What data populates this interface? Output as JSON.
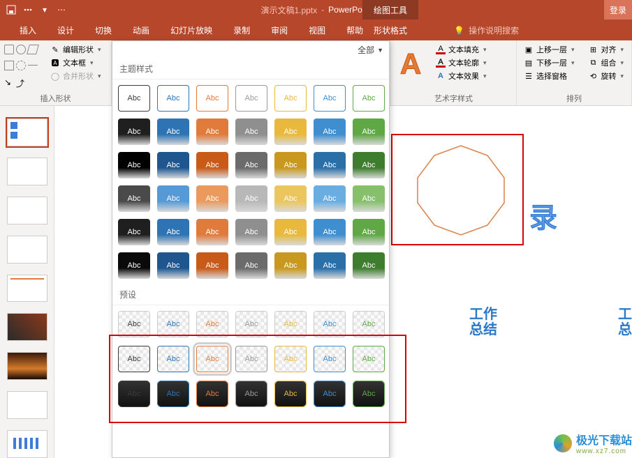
{
  "title": {
    "filename": "演示文稿1.pptx",
    "separator": "-",
    "appname": "PowerPoint",
    "context_tool": "绘图工具",
    "login": "登录"
  },
  "tabs": {
    "insert": "插入",
    "design": "设计",
    "transition": "切换",
    "animation": "动画",
    "slideshow": "幻灯片放映",
    "record": "录制",
    "review": "审阅",
    "view": "视图",
    "help": "帮助",
    "shape_format": "形状格式",
    "tellme": "操作说明搜索"
  },
  "ribbon": {
    "insert_shape_group": "插入形状",
    "edit_shape": "编辑形状",
    "text_box": "文本框",
    "merge_shape": "合并形状",
    "wordart_group": "艺术字样式",
    "text_fill": "文本填充",
    "text_outline": "文本轮廓",
    "text_effect": "文本效果",
    "arrange_group": "排列",
    "bring_forward": "上移一层",
    "send_backward": "下移一层",
    "selection_pane": "选择窗格",
    "align": "对齐",
    "group": "组合",
    "rotate": "旋转"
  },
  "gallery": {
    "filter_all": "全部",
    "section_theme": "主题样式",
    "section_preset": "预设",
    "sample_text": "Abc",
    "row1_colors": [
      "#3a3a3a",
      "#2e74b5",
      "#e07b3c",
      "#9a9a9a",
      "#e8b93c",
      "#3e8ed0",
      "#5fa845"
    ],
    "solid_rows": [
      [
        "#1f1f1f",
        "#2e74b5",
        "#e07b3c",
        "#8f8f8f",
        "#e8b93c",
        "#3e8ed0",
        "#5fa845"
      ],
      [
        "#000000",
        "#1f5690",
        "#c85a1a",
        "#6b6b6b",
        "#c9981e",
        "#2a6fa8",
        "#3f7d2e"
      ],
      [
        "#4a4a4a",
        "#559ad6",
        "#ea9a5d",
        "#b8b8b8",
        "#ecc55e",
        "#6aade0",
        "#86c06a"
      ],
      [
        "#1f1f1f",
        "#2e74b5",
        "#e07b3c",
        "#8f8f8f",
        "#e8b93c",
        "#3e8ed0",
        "#5fa845"
      ],
      [
        "#0a0a0a",
        "#1f5690",
        "#c85a1a",
        "#6b6b6b",
        "#c9981e",
        "#2a6fa8",
        "#3f7d2e"
      ]
    ],
    "preset_colors": [
      "#3a3a3a",
      "#2e74b5",
      "#e07b3c",
      "#9a9a9a",
      "#e8b93c",
      "#3e8ed0",
      "#5fa845"
    ]
  },
  "slide": {
    "lu_char": "录",
    "work": "工作",
    "summary": "总结",
    "work_edge1": "工",
    "work_edge2": "总"
  },
  "watermark": {
    "main": "极光下载站",
    "sub": "www.xz7.com"
  }
}
